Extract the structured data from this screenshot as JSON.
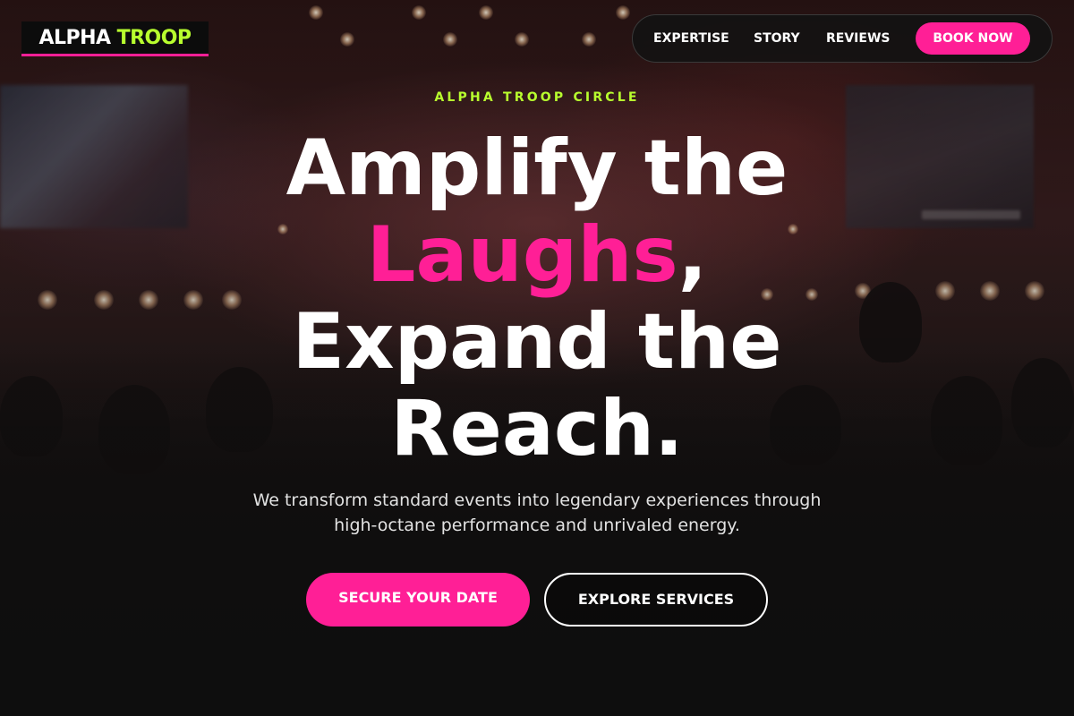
{
  "brand": {
    "name_part1": "ALPHA",
    "name_part2": "TROOP"
  },
  "nav": {
    "links": [
      "EXPERTISE",
      "STORY",
      "REVIEWS"
    ],
    "cta": "BOOK NOW"
  },
  "hero": {
    "eyebrow": "ALPHA TROOP CIRCLE",
    "headline": {
      "line1": "Amplify the",
      "line2_highlight": "Laughs",
      "line2_rest": ",",
      "line3": "Expand the",
      "line4": "Reach."
    },
    "subtitle": {
      "line1": "We transform standard events into legendary experiences through",
      "line2": "high-octane performance and unrivaled energy."
    },
    "primary_cta": "SECURE YOUR DATE",
    "secondary_cta": "EXPLORE SERVICES"
  },
  "colors": {
    "accent_pink": "#ff1f96",
    "accent_lime": "#b8ff2e",
    "background": "#141414"
  }
}
